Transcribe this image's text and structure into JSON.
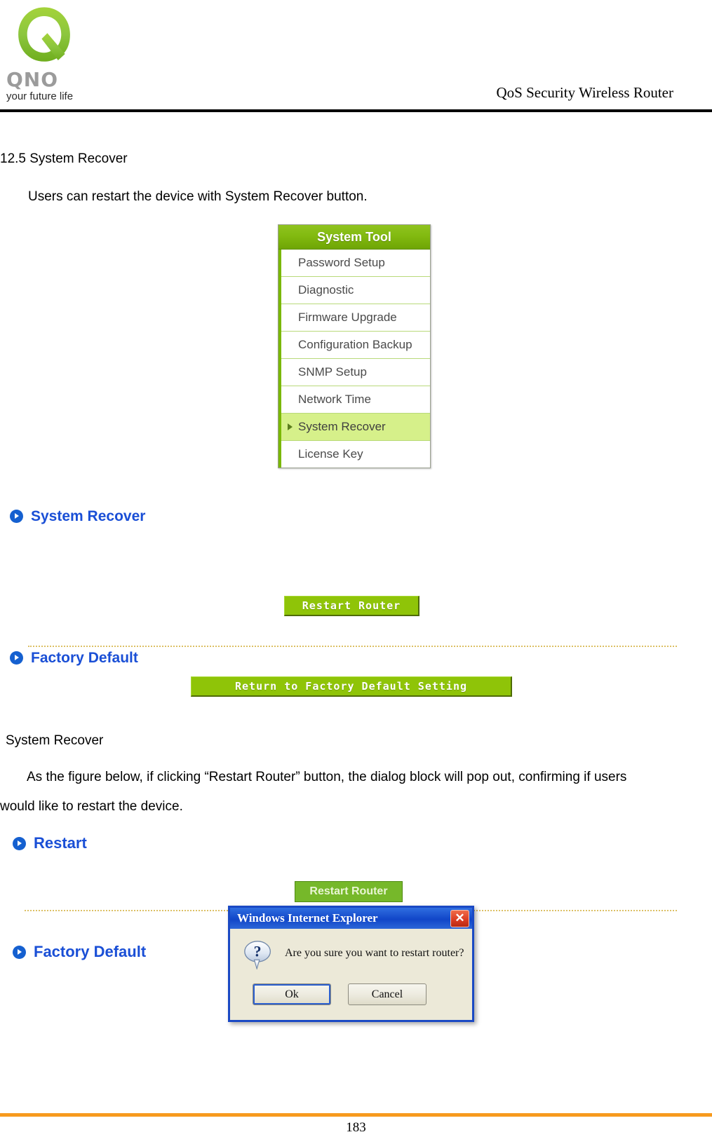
{
  "header": {
    "logo_wordmark": "QNO",
    "logo_tagline": "your future life",
    "title": "QoS Security Wireless Router"
  },
  "document": {
    "section_number_title": "12.5 System Recover",
    "intro_paragraph": "Users can restart the device with System Recover button.",
    "caption_system_recover": "System Recover",
    "body_line_1": "As the figure below, if clicking “Restart Router” button, the dialog block will pop out, confirming if users",
    "body_line_2": "would like to restart the device.",
    "page_number": "183"
  },
  "system_tool_menu": {
    "title": "System Tool",
    "items": [
      {
        "label": "Password Setup",
        "selected": false
      },
      {
        "label": "Diagnostic",
        "selected": false
      },
      {
        "label": "Firmware Upgrade",
        "selected": false
      },
      {
        "label": "Configuration Backup",
        "selected": false
      },
      {
        "label": "SNMP Setup",
        "selected": false
      },
      {
        "label": "Network Time",
        "selected": false
      },
      {
        "label": "System Recover",
        "selected": true
      },
      {
        "label": "License Key",
        "selected": false
      }
    ]
  },
  "panel_one": {
    "system_recover_heading": "System Recover",
    "restart_router_button": "Restart Router",
    "factory_default_heading": "Factory Default",
    "factory_default_button": "Return to Factory Default Setting"
  },
  "panel_two": {
    "restart_heading": "Restart",
    "restart_router_button": "Restart Router",
    "factory_default_heading": "Factory Default"
  },
  "ie_dialog": {
    "title": "Windows Internet Explorer",
    "close_label": "✕",
    "message": "Are you sure you want to restart router?",
    "ok_label": "Ok",
    "cancel_label": "Cancel",
    "icon": "question-mark"
  },
  "colors": {
    "brand_green": "#8fc408",
    "menu_highlight": "#d6f08a",
    "heading_blue": "#1a4fd6",
    "footer_orange": "#f79a1e",
    "dialog_titlebar_blue": "#1146c8",
    "dialog_face": "#ece9d8",
    "close_red": "#d93a20"
  }
}
